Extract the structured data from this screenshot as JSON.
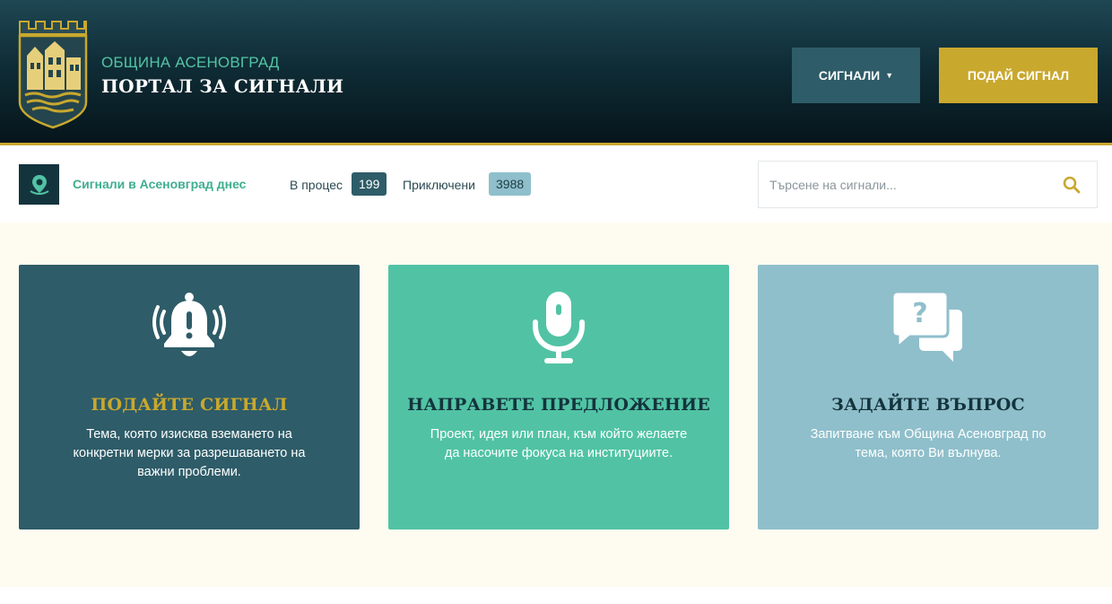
{
  "header": {
    "brand_subtitle": "ОБЩИНА АСЕНОВГРАД",
    "brand_title": "ПОРТАЛ ЗА СИГНАЛИ",
    "signals_menu_label": "СИГНАЛИ",
    "submit_signal_label": "ПОДАЙ СИГНАЛ"
  },
  "stats": {
    "title": "Сигнали в Асеновград днес",
    "in_progress_label": "В процес",
    "in_progress_count": "199",
    "closed_label": "Приключени",
    "closed_count": "3988",
    "search_placeholder": "Търсене на сигнали..."
  },
  "cards": [
    {
      "icon": "alarm-bell-icon",
      "title": "ПОДАЙТЕ СИГНАЛ",
      "description": "Тема, която изисква вземането на конкретни мерки за разрешаването на важни проблеми."
    },
    {
      "icon": "microphone-icon",
      "title": "НАПРАВЕТЕ ПРЕДЛОЖЕНИЕ",
      "description": "Проект, идея или план, към който желаете да насочите фокуса на институциите."
    },
    {
      "icon": "question-chat-icon",
      "title": "ЗАДАЙТЕ ВЪПРОС",
      "description": "Запитване към Община Асеновград по тема, която Ви вълнува."
    }
  ],
  "colors": {
    "header_dark": "#0f2d37",
    "teal_dark": "#2e5c68",
    "mint": "#51c3a4",
    "light_blue": "#8fbfcb",
    "gold": "#c9a82e",
    "cream": "#fefcf1"
  }
}
